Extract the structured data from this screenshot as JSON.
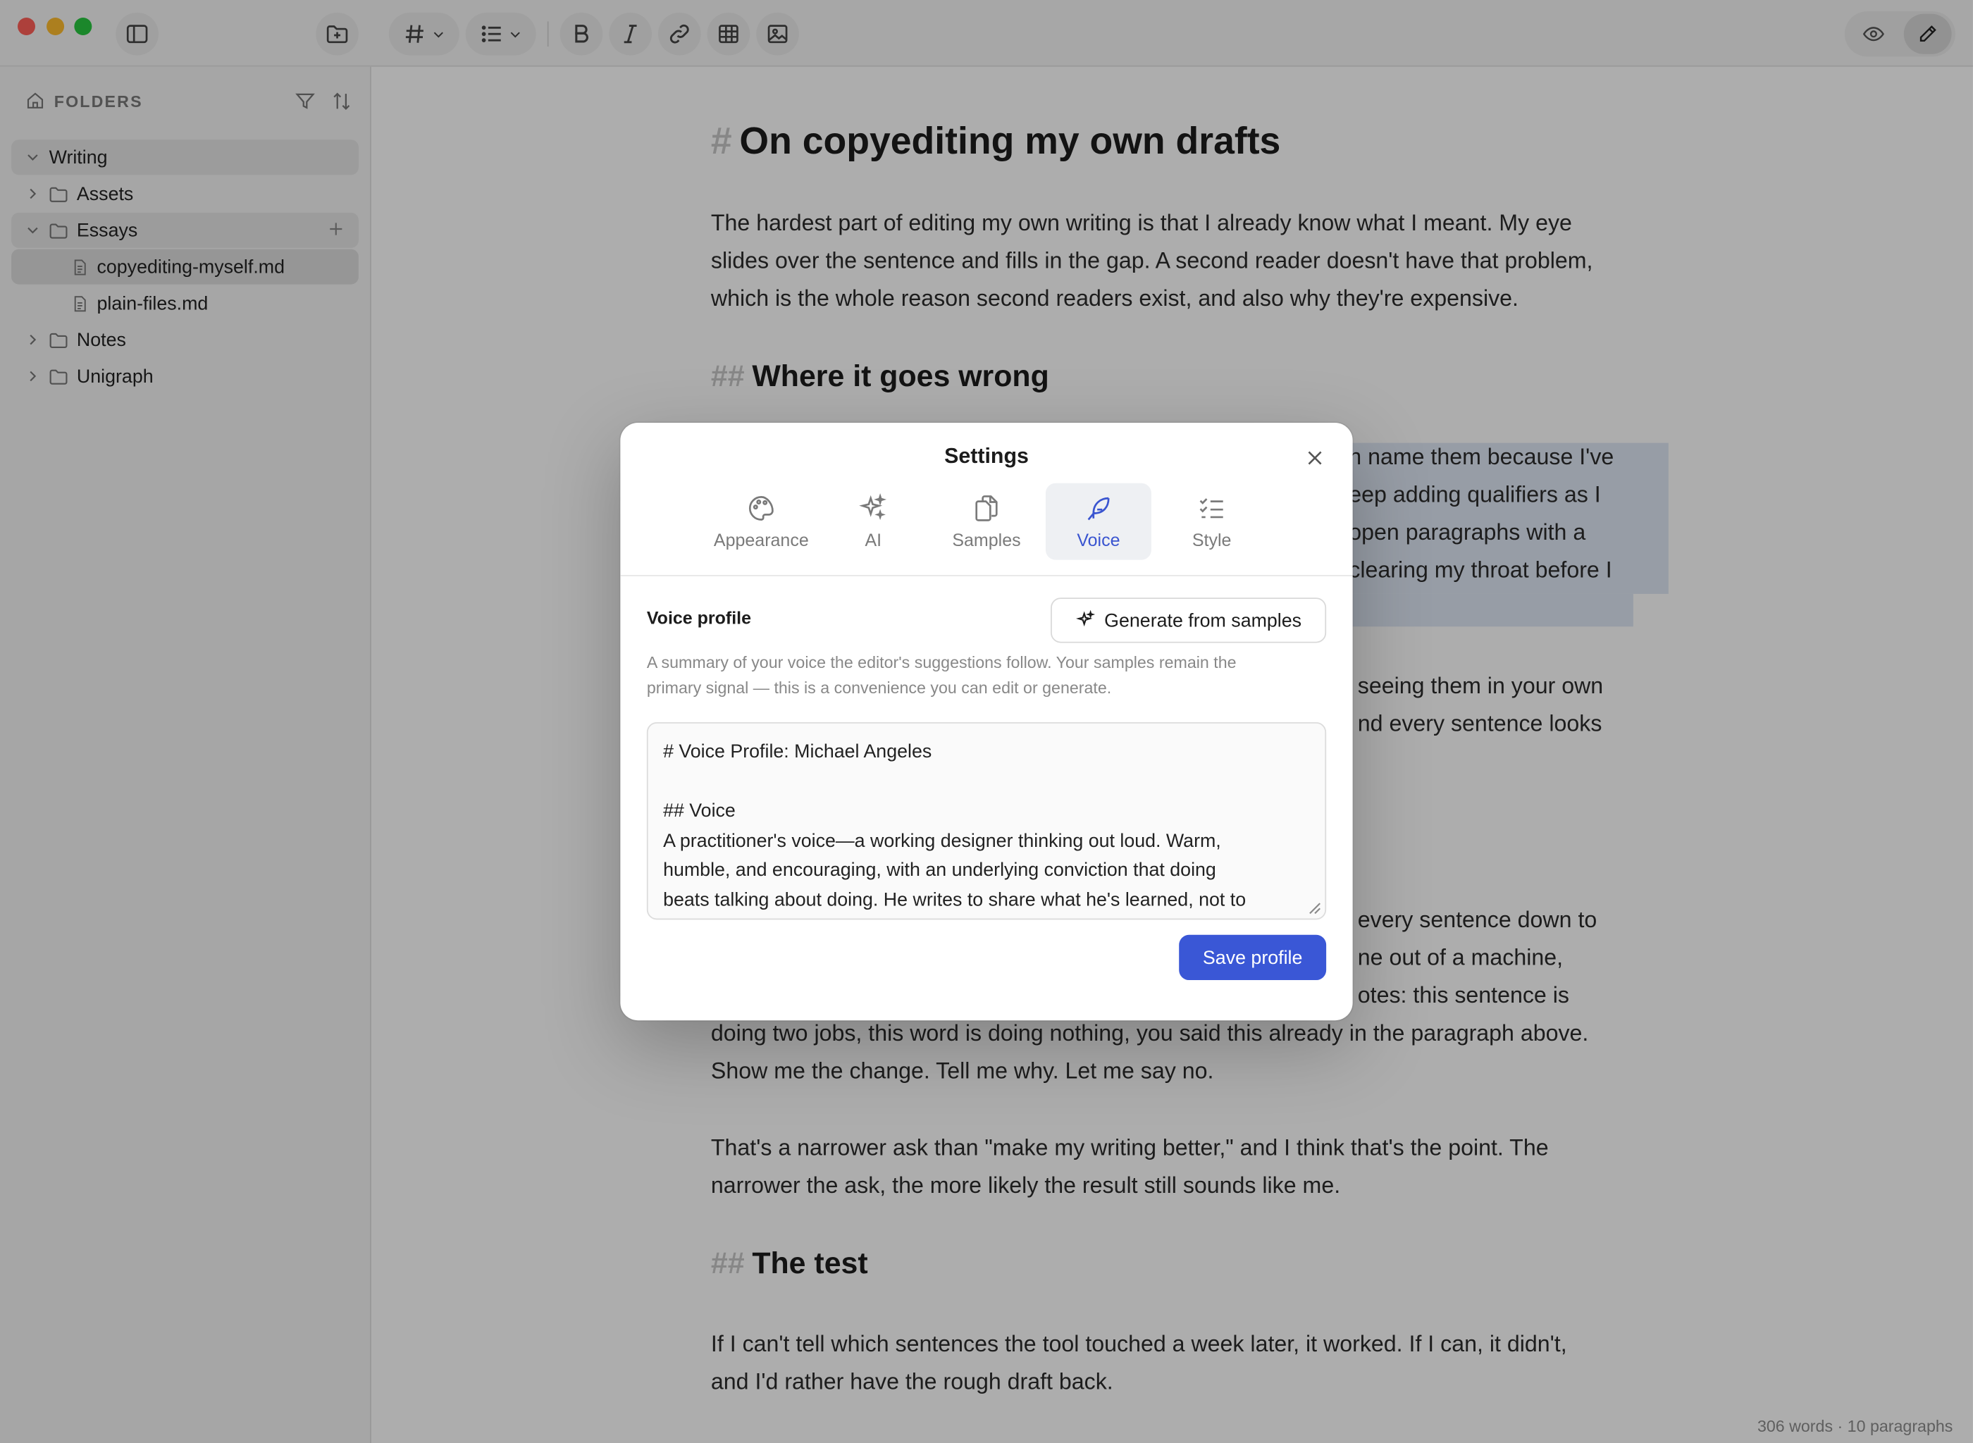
{
  "window": {
    "traffic_lights": [
      "close",
      "minimize",
      "zoom"
    ],
    "colors": {
      "close": "#ff5f57",
      "minimize": "#febc2e",
      "zoom": "#28c840",
      "accent": "#3a57d6"
    }
  },
  "toolbar": {
    "icons": [
      "sidebar-toggle-icon",
      "new-folder-icon",
      "heading-icon",
      "list-icon",
      "bold-icon",
      "italic-icon",
      "link-icon",
      "table-icon",
      "image-icon",
      "preview-icon",
      "edit-icon"
    ],
    "active_mode": "edit"
  },
  "sidebar": {
    "title": "FOLDERS",
    "tree": [
      {
        "label": "Writing",
        "type": "root",
        "expanded": true
      },
      {
        "label": "Assets",
        "type": "folder",
        "expanded": false
      },
      {
        "label": "Essays",
        "type": "folder",
        "expanded": true
      },
      {
        "label": "copyediting-myself.md",
        "type": "file",
        "selected": true
      },
      {
        "label": "plain-files.md",
        "type": "file"
      },
      {
        "label": "Notes",
        "type": "folder",
        "expanded": false
      },
      {
        "label": "Unigraph",
        "type": "folder",
        "expanded": false
      }
    ]
  },
  "document": {
    "h1_mark": "#",
    "h2_mark": "##",
    "title": "On copyediting my own drafts",
    "intro": [
      "The hardest part of editing my own writing is that I already know what I meant. My eye",
      "slides over the sentence and fills in the gap. A second reader doesn't have that problem,",
      "which is the whole reason second readers exist, and also why they're expensive."
    ],
    "section1_title": "Where it goes wrong",
    "section1_visible": [
      "n name them because I've",
      "eep adding qualifiers as I",
      "open paragraphs with a",
      "clearing my throat before I"
    ],
    "section1b_visible": [
      "seeing them in your own",
      "nd every sentence looks"
    ],
    "section2_visible": [
      "every sentence down to",
      "ne out of a machine,",
      "otes: this sentence is"
    ],
    "section2_full": [
      "doing two jobs, this word is doing nothing, you said this already in the paragraph above.",
      "Show me the change. Tell me why. Let me say no."
    ],
    "para_narrow": [
      "That's a narrower ask than \"make my writing better,\" and I think that's the point. The",
      "narrower the ask, the more likely the result still sounds like me."
    ],
    "section3_title": "The test",
    "para_test": [
      "If I can't tell which sentences the tool touched a week later, it worked. If I can, it didn't,",
      "and I'd rather have the rough draft back."
    ]
  },
  "status": {
    "text": "306 words · 10 paragraphs"
  },
  "settings": {
    "title": "Settings",
    "tabs": [
      {
        "label": "Appearance",
        "icon": "palette-icon"
      },
      {
        "label": "AI",
        "icon": "sparkles-icon"
      },
      {
        "label": "Samples",
        "icon": "documents-icon"
      },
      {
        "label": "Voice",
        "icon": "feather-icon",
        "active": true
      },
      {
        "label": "Style",
        "icon": "checklist-icon"
      }
    ],
    "voice_profile_label": "Voice profile",
    "generate_button": "Generate from samples",
    "help": [
      "A summary of your voice the editor's suggestions follow. Your samples remain the",
      "primary signal — this is a convenience you can edit or generate."
    ],
    "textarea_lines": [
      "# Voice Profile: Michael Angeles",
      "",
      "## Voice",
      "A practitioner's voice—a working designer thinking out loud. Warm,",
      "humble, and encouraging, with an underlying conviction that doing",
      "beats talking about doing. He writes to share what he's learned, not to"
    ],
    "save_button": "Save profile"
  }
}
